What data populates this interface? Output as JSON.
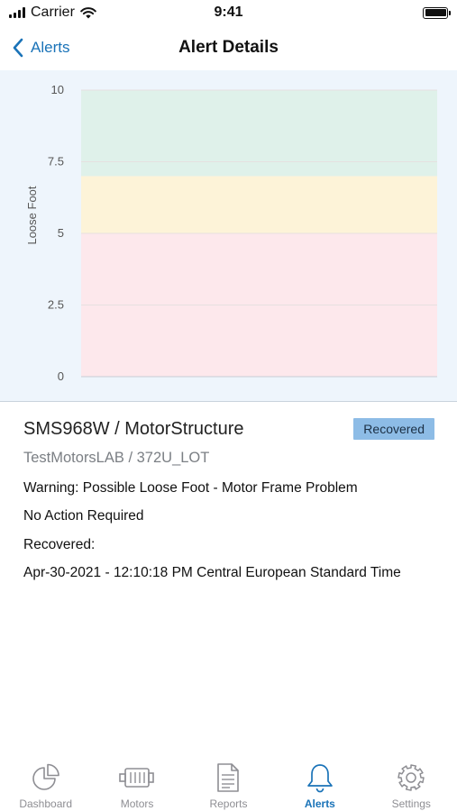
{
  "status_bar": {
    "carrier": "Carrier",
    "time": "9:41"
  },
  "nav": {
    "back_label": "Alerts",
    "title": "Alert Details"
  },
  "chart_data": {
    "type": "area",
    "ylabel": "Loose Foot",
    "xlabel": "",
    "ylim": [
      0,
      10
    ],
    "yticks": [
      "0",
      "2.5",
      "5",
      "7.5",
      "10"
    ],
    "bands": [
      {
        "from": 0,
        "to": 5,
        "color": "#fde8ec"
      },
      {
        "from": 5,
        "to": 7,
        "color": "#fdf3d8"
      },
      {
        "from": 7,
        "to": 10,
        "color": "#dff1ea"
      }
    ],
    "grid": true,
    "series": []
  },
  "alert": {
    "device": "SMS968W / MotorStructure",
    "status": "Recovered",
    "location": "TestMotorsLAB / 372U_LOT",
    "warning": "Warning: Possible Loose Foot - Motor Frame Problem",
    "action": "No Action Required",
    "recovered_label": "Recovered:",
    "recovered_time": "Apr-30-2021 - 12:10:18 PM Central European Standard Time"
  },
  "tabs": [
    {
      "label": "Dashboard",
      "icon": "pie-chart-icon",
      "active": false
    },
    {
      "label": "Motors",
      "icon": "motor-icon",
      "active": false
    },
    {
      "label": "Reports",
      "icon": "document-icon",
      "active": false
    },
    {
      "label": "Alerts",
      "icon": "bell-icon",
      "active": true
    },
    {
      "label": "Settings",
      "icon": "gear-icon",
      "active": false
    }
  ],
  "colors": {
    "accent": "#1a73b8",
    "badge": "#8dbce6",
    "chart_bg": "#eef5fc"
  }
}
